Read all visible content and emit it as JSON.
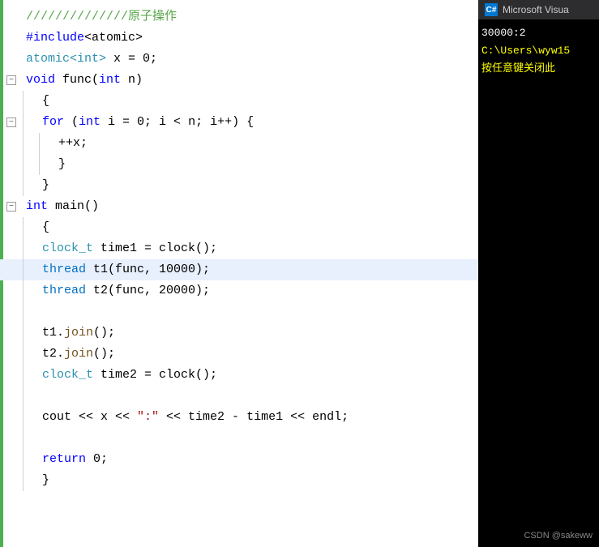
{
  "editor": {
    "lines": [
      {
        "id": 1,
        "gutter": "none",
        "indent": 0,
        "tokens": [
          {
            "text": "//////////////原子操作",
            "class": "c-comment"
          }
        ],
        "highlight": false,
        "green": true
      },
      {
        "id": 2,
        "gutter": "none",
        "indent": 0,
        "tokens": [
          {
            "text": "#include",
            "class": "c-keyword"
          },
          {
            "text": "<atomic>",
            "class": "c-plain"
          }
        ],
        "highlight": false,
        "green": true
      },
      {
        "id": 3,
        "gutter": "none",
        "indent": 0,
        "tokens": [
          {
            "text": "atomic<int>",
            "class": "c-type"
          },
          {
            "text": " x = 0;",
            "class": "c-plain"
          }
        ],
        "highlight": false,
        "green": true
      },
      {
        "id": 4,
        "gutter": "collapse",
        "indent": 0,
        "tokens": [
          {
            "text": "void",
            "class": "c-keyword"
          },
          {
            "text": " func(",
            "class": "c-plain"
          },
          {
            "text": "int",
            "class": "c-keyword"
          },
          {
            "text": " n)",
            "class": "c-plain"
          }
        ],
        "highlight": false,
        "green": true
      },
      {
        "id": 5,
        "gutter": "none",
        "indent": 1,
        "tokens": [
          {
            "text": "{",
            "class": "c-plain"
          }
        ],
        "highlight": false,
        "green": true
      },
      {
        "id": 6,
        "gutter": "collapse",
        "indent": 1,
        "tokens": [
          {
            "text": "for",
            "class": "c-keyword"
          },
          {
            "text": " (",
            "class": "c-plain"
          },
          {
            "text": "int",
            "class": "c-keyword"
          },
          {
            "text": " i = 0; i < n; i++) {",
            "class": "c-plain"
          }
        ],
        "highlight": false,
        "green": true
      },
      {
        "id": 7,
        "gutter": "none",
        "indent": 2,
        "tokens": [
          {
            "text": "++x;",
            "class": "c-plain"
          }
        ],
        "highlight": false,
        "green": true
      },
      {
        "id": 8,
        "gutter": "none",
        "indent": 2,
        "tokens": [
          {
            "text": "}",
            "class": "c-plain"
          }
        ],
        "highlight": false,
        "green": true
      },
      {
        "id": 9,
        "gutter": "none",
        "indent": 1,
        "tokens": [
          {
            "text": "}",
            "class": "c-plain"
          }
        ],
        "highlight": false,
        "green": true
      },
      {
        "id": 10,
        "gutter": "collapse",
        "indent": 0,
        "tokens": [
          {
            "text": "int",
            "class": "c-keyword"
          },
          {
            "text": " main()",
            "class": "c-plain"
          }
        ],
        "highlight": false,
        "green": true
      },
      {
        "id": 11,
        "gutter": "none",
        "indent": 1,
        "tokens": [
          {
            "text": "{",
            "class": "c-plain"
          }
        ],
        "highlight": false,
        "green": true
      },
      {
        "id": 12,
        "gutter": "none",
        "indent": 1,
        "tokens": [
          {
            "text": "clock_t",
            "class": "c-type"
          },
          {
            "text": " time1 = clock();",
            "class": "c-plain"
          }
        ],
        "highlight": false,
        "green": true
      },
      {
        "id": 13,
        "gutter": "none",
        "indent": 1,
        "tokens": [
          {
            "text": "thread",
            "class": "c-thread"
          },
          {
            "text": " t1(func, 10000);",
            "class": "c-plain"
          }
        ],
        "highlight": true,
        "green": true
      },
      {
        "id": 14,
        "gutter": "none",
        "indent": 1,
        "tokens": [
          {
            "text": "thread",
            "class": "c-thread"
          },
          {
            "text": " t2(func, 20000);",
            "class": "c-plain"
          }
        ],
        "highlight": false,
        "green": true
      },
      {
        "id": 15,
        "gutter": "none",
        "indent": 1,
        "tokens": [],
        "highlight": false,
        "green": true
      },
      {
        "id": 16,
        "gutter": "none",
        "indent": 1,
        "tokens": [
          {
            "text": "t1.",
            "class": "c-plain"
          },
          {
            "text": "join",
            "class": "c-func"
          },
          {
            "text": "();",
            "class": "c-plain"
          }
        ],
        "highlight": false,
        "green": true
      },
      {
        "id": 17,
        "gutter": "none",
        "indent": 1,
        "tokens": [
          {
            "text": "t2.",
            "class": "c-plain"
          },
          {
            "text": "join",
            "class": "c-func"
          },
          {
            "text": "();",
            "class": "c-plain"
          }
        ],
        "highlight": false,
        "green": true
      },
      {
        "id": 18,
        "gutter": "none",
        "indent": 1,
        "tokens": [
          {
            "text": "clock_t",
            "class": "c-type"
          },
          {
            "text": " time2 = clock();",
            "class": "c-plain"
          }
        ],
        "highlight": false,
        "green": true
      },
      {
        "id": 19,
        "gutter": "none",
        "indent": 1,
        "tokens": [],
        "highlight": false,
        "green": true
      },
      {
        "id": 20,
        "gutter": "none",
        "indent": 1,
        "tokens": [
          {
            "text": "cout << x << ",
            "class": "c-plain"
          },
          {
            "text": "\":\"",
            "class": "c-string"
          },
          {
            "text": " << time2 - time1 << endl;",
            "class": "c-plain"
          }
        ],
        "highlight": false,
        "green": true
      },
      {
        "id": 21,
        "gutter": "none",
        "indent": 1,
        "tokens": [],
        "highlight": false,
        "green": true
      },
      {
        "id": 22,
        "gutter": "none",
        "indent": 1,
        "tokens": [
          {
            "text": "return",
            "class": "c-keyword"
          },
          {
            "text": " 0;",
            "class": "c-plain"
          }
        ],
        "highlight": false,
        "green": true
      },
      {
        "id": 23,
        "gutter": "none",
        "indent": 1,
        "tokens": [
          {
            "text": "}",
            "class": "c-plain"
          }
        ],
        "highlight": false,
        "green": true
      }
    ]
  },
  "terminal": {
    "title": "Microsoft Visua",
    "icon_label": "C#",
    "lines": [
      {
        "text": "30000:2",
        "class": "t-white"
      },
      {
        "text": "",
        "class": ""
      },
      {
        "text": "C:\\Users\\wyw15",
        "class": "t-yellow"
      },
      {
        "text": "按任意键关闭此",
        "class": "t-yellow"
      }
    ],
    "footer": "CSDN @sakeww"
  }
}
